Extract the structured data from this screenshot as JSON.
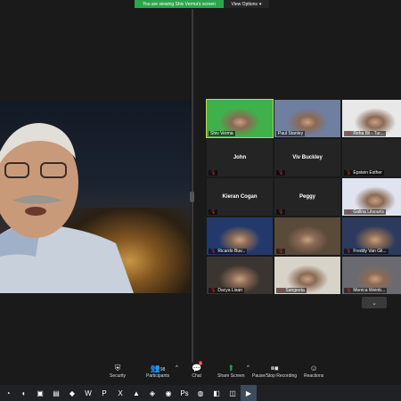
{
  "share_banner": {
    "message": "You are viewing Shiv Verma's screen",
    "view_options": "View Options"
  },
  "grid_tiles": [
    {
      "type": "video",
      "name": "Shiv Verma",
      "muted": false,
      "active": true,
      "bg": "#3fb14a"
    },
    {
      "type": "video",
      "name": "Paul Stanley",
      "muted": false,
      "active": false,
      "bg": "#6f7fa0"
    },
    {
      "type": "video",
      "name": "Reha Bil - Tur...",
      "muted": true,
      "active": false,
      "bg": "#e8e8e8"
    },
    {
      "type": "name",
      "center": "John",
      "name": "",
      "muted": true
    },
    {
      "type": "name",
      "center": "Viv Buckley",
      "name": "",
      "muted": true
    },
    {
      "type": "name",
      "center": "",
      "name": "Epstein Esther",
      "muted": true
    },
    {
      "type": "name",
      "center": "Kieran Cogan",
      "name": "",
      "muted": true
    },
    {
      "type": "name",
      "center": "Peggy",
      "name": "",
      "muted": true
    },
    {
      "type": "video",
      "name": "Galina Litsouris",
      "muted": true,
      "active": false,
      "bg": "#dfe4f0"
    },
    {
      "type": "video",
      "name": "Ricardo Buv...",
      "muted": true,
      "active": false,
      "bg": "#23396b"
    },
    {
      "type": "video",
      "name": "",
      "muted": true,
      "active": false,
      "bg": "#5a4a3a"
    },
    {
      "type": "video",
      "name": "Freddy Van Gil...",
      "muted": true,
      "active": false,
      "bg": "#2c3a5e"
    },
    {
      "type": "video",
      "name": "Dacya Lisan",
      "muted": true,
      "active": false,
      "bg": "#3a3530"
    },
    {
      "type": "video",
      "name": "Sangeeta",
      "muted": true,
      "active": false,
      "bg": "#d8d3c8"
    },
    {
      "type": "video",
      "name": "Monica Weinb...",
      "muted": true,
      "active": false,
      "bg": "#6a6a70"
    }
  ],
  "toolbar": {
    "security": "Security",
    "participants": "Participants",
    "participants_count": "98",
    "chat": "Chat",
    "chat_badge": "2",
    "share_screen": "Share Screen",
    "record": "Pause/Stop Recording",
    "reactions": "Reactions"
  },
  "taskbar": {
    "items": [
      "search-icon",
      "edge-icon",
      "store-icon",
      "folder-icon",
      "app-icon",
      "word-icon",
      "powerpoint-icon",
      "excel-icon",
      "app-icon",
      "app-icon",
      "app-icon",
      "photoshop-icon",
      "chrome-icon",
      "app-icon",
      "app-icon",
      "zoom-icon"
    ],
    "glyphs": [
      "◔",
      "◐",
      "▣",
      "▤",
      "◆",
      "W",
      "P",
      "X",
      "▲",
      "◈",
      "◉",
      "Ps",
      "◍",
      "◧",
      "◫",
      "▶"
    ]
  }
}
